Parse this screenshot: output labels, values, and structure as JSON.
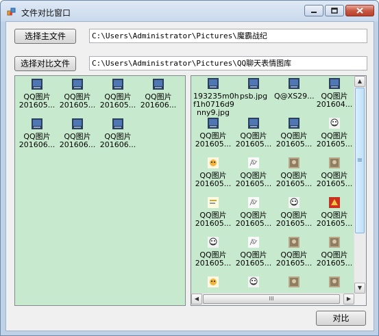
{
  "window": {
    "title": "文件对比窗口",
    "icon": "app-icon"
  },
  "buttons": {
    "select_main": "选择主文件",
    "select_compare": "选择对比文件",
    "compare": "对比"
  },
  "paths": {
    "main": "C:\\Users\\Administrator\\Pictures\\魔霸战纪",
    "compare": "C:\\Users\\Administrator\\Pictures\\QQ聊天表情图库"
  },
  "left_pane": {
    "items": [
      {
        "name": "QQ图片",
        "sub": "201605...",
        "icon": "screen-thumb-icon"
      },
      {
        "name": "QQ图片",
        "sub": "201605...",
        "icon": "screen-thumb-icon"
      },
      {
        "name": "QQ图片",
        "sub": "201605...",
        "icon": "screen-thumb-icon"
      },
      {
        "name": "QQ图片",
        "sub": "201606...",
        "icon": "screen-thumb-icon"
      },
      {
        "name": "QQ图片",
        "sub": "201606...",
        "icon": "screen-thumb-icon"
      },
      {
        "name": "QQ图片",
        "sub": "201606...",
        "icon": "screen-thumb-icon"
      },
      {
        "name": "QQ图片",
        "sub": "201606...",
        "icon": "screen-thumb-icon"
      }
    ]
  },
  "right_pane": {
    "items": [
      {
        "name": "193235m0h",
        "sub": "f1h0716d9",
        "sub2": "nny9.jpg",
        "icon": "screen-thumb-icon"
      },
      {
        "name": "psb.jpg",
        "sub": "",
        "icon": "screen-thumb-icon"
      },
      {
        "name": "Q@XS29...",
        "sub": "",
        "icon": "screen-thumb-icon"
      },
      {
        "name": "QQ图片",
        "sub": "201604...",
        "icon": "screen-thumb-icon"
      },
      {
        "name": "QQ图片",
        "sub": "201605...",
        "icon": "screen-thumb-icon"
      },
      {
        "name": "QQ图片",
        "sub": "201605...",
        "icon": "screen-thumb-icon"
      },
      {
        "name": "QQ图片",
        "sub": "201605...",
        "icon": "screen-thumb-icon"
      },
      {
        "name": "QQ图片",
        "sub": "201605...",
        "icon": "face-thumb-icon"
      },
      {
        "name": "QQ图片",
        "sub": "201605...",
        "icon": "cartoon-thumb-icon"
      },
      {
        "name": "QQ图片",
        "sub": "201605...",
        "icon": "sketch-thumb-icon"
      },
      {
        "name": "QQ图片",
        "sub": "201605...",
        "icon": "photo-thumb-icon"
      },
      {
        "name": "QQ图片",
        "sub": "201605...",
        "icon": "photo-thumb-icon"
      },
      {
        "name": "QQ图片",
        "sub": "201605...",
        "icon": "text-thumb-icon"
      },
      {
        "name": "QQ图片",
        "sub": "201605...",
        "icon": "sketch-thumb-icon"
      },
      {
        "name": "QQ图片",
        "sub": "201605...",
        "icon": "face-thumb-icon"
      },
      {
        "name": "QQ图片",
        "sub": "201605...",
        "icon": "red-thumb-icon"
      },
      {
        "name": "QQ图片",
        "sub": "201605...",
        "icon": "face-thumb-icon"
      },
      {
        "name": "QQ图片",
        "sub": "201605...",
        "icon": "sketch-thumb-icon"
      },
      {
        "name": "QQ图片",
        "sub": "201605...",
        "icon": "photo-thumb-icon"
      },
      {
        "name": "QQ图片",
        "sub": "201605...",
        "icon": "photo-thumb-icon"
      },
      {
        "name": "",
        "sub": "",
        "icon": "cartoon-thumb-icon"
      },
      {
        "name": "",
        "sub": "",
        "icon": "face-thumb-icon"
      },
      {
        "name": "",
        "sub": "",
        "icon": "photo-thumb-icon"
      },
      {
        "name": "",
        "sub": "",
        "icon": "photo-thumb-icon"
      }
    ],
    "vscroll_position": 0.0,
    "hscroll_position": 0.0
  },
  "scroll_glyphs": {
    "up": "▲",
    "down": "▼",
    "left": "◀",
    "right": "▶",
    "grip": "≡",
    "hgrip": "III"
  }
}
